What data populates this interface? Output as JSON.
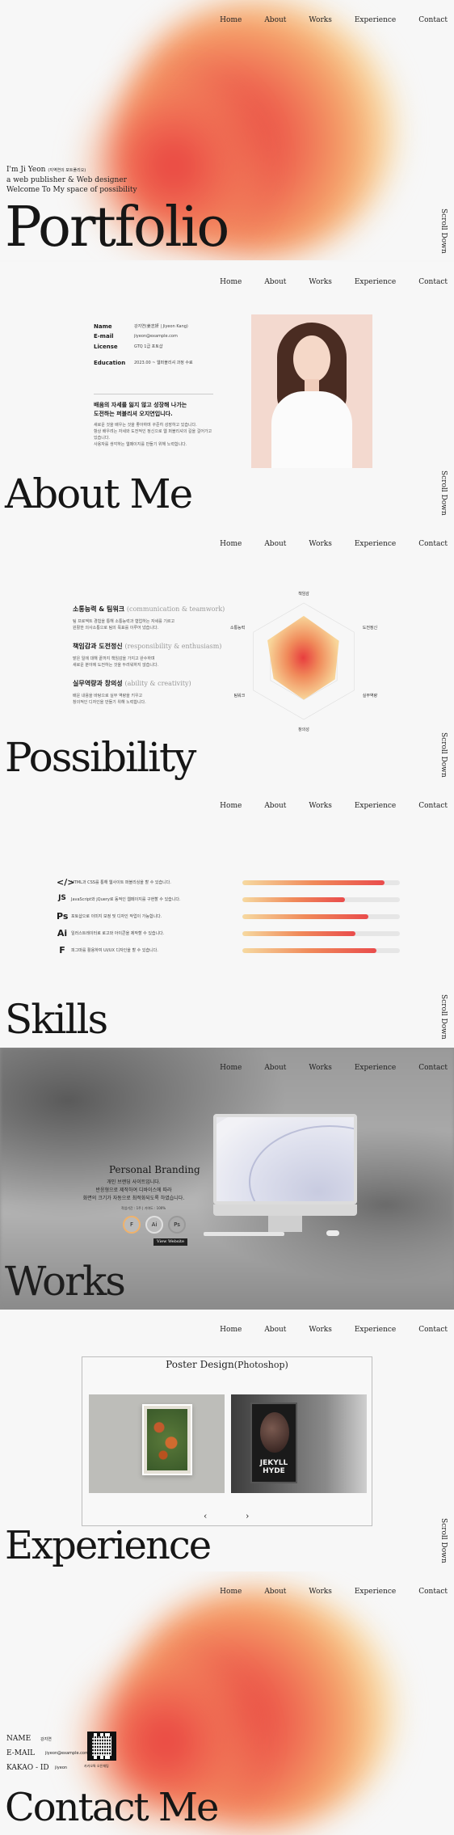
{
  "nav": [
    "Home",
    "About",
    "Works",
    "Experience",
    "Contact"
  ],
  "scroll_label": "Scroll Down",
  "hero": {
    "line1": "I'm Ji Yeon",
    "line1_small": "(지역연의 포트폴리오)",
    "line2": "a  web publisher & Web designer",
    "line3": "Welcome To My space of possibility",
    "title": "Portfolio"
  },
  "about": {
    "title": "About Me",
    "rows": [
      {
        "k": "Name",
        "v": "강지연(姜志妍 | Jiyeon Kang)"
      },
      {
        "k": "E-mail",
        "v": "jiyeon@example.com"
      },
      {
        "k": "License",
        "v": "GTQ 1급 포토샵"
      },
      {
        "k": "Education",
        "v": "2023.00 ~ 웹퍼블리셔 과정 수료"
      }
    ],
    "headline": "배움의 자세를 잃지 않고 성장해 나가는\n도전하는 퍼블리셔 오지연입니다.",
    "desc": "새로운 것을 배우는 것을 좋아하며 꾸준히 성장하고 있습니다.\n항상 배우려는 자세와 도전적인 정신으로 웹 퍼블리셔의 길을 걸어가고 있습니다.\n사용자를 생각하는 웹페이지를 만들기 위해 노력합니다."
  },
  "possibility": {
    "title": "Possibility",
    "items": [
      {
        "h": "소통능력 & 팀워크",
        "en": "(communication & teamwork)",
        "d": "팀 프로젝트 경험을 통해 소통능력과 협업하는 자세를 기르고\n원활한 의사소통으로 팀의 목표를 이루어 냈습니다."
      },
      {
        "h": "책임감과 도전정신",
        "en": "(responsibility & enthusiasm)",
        "d": "맡은 일에 대해 끝까지 책임감을 가지고 완수하며\n새로운 분야에 도전하는 것을 두려워하지 않습니다."
      },
      {
        "h": "실무역량과 창의성",
        "en": "(ability & creativity)",
        "d": "배운 내용을 바탕으로 실무 역량을 키우고\n창의적인 디자인을 만들기 위해 노력합니다."
      }
    ],
    "chart_labels": [
      "책임감",
      "도전정신",
      "실무역량",
      "창의성",
      "팀워크",
      "소통능력"
    ],
    "chart_values": [
      0.78,
      0.7,
      0.62,
      0.66,
      0.6,
      0.72
    ]
  },
  "skills": {
    "title": "Skills",
    "rows": [
      {
        "icon": "HTML",
        "text": "HTML과 CSS를 통해 웹사이트 퍼블리싱을 할 수 있습니다.",
        "level": 0.9
      },
      {
        "icon": "JS",
        "text": "JavaScript와 jQuery로 동적인 웹페이지를 구현할 수 있습니다.",
        "level": 0.65
      },
      {
        "icon": "Ps",
        "text": "포토샵으로 이미지 보정 및 디자인 작업이 가능합니다.",
        "level": 0.8
      },
      {
        "icon": "Ai",
        "text": "일러스트레이터로 로고와 아이콘을 제작할 수 있습니다.",
        "level": 0.72
      },
      {
        "icon": "F",
        "text": "피그마를 활용하여 UI/UX 디자인을 할 수 있습니다.",
        "level": 0.85
      }
    ]
  },
  "works": {
    "title": "Works",
    "project_title": "Personal Branding",
    "project_desc": "개인 브랜딩 사이트입니다.\n반응형으로 제작하여 디바이스에 따라\n화면의 크기가 자동으로 최적화되도록 하였습니다.",
    "period": "작업기간 : 1주 | 기여도 : 100%",
    "tools": [
      "F",
      "Ai",
      "Ps"
    ],
    "button": "View Website"
  },
  "experience": {
    "title": "Experience",
    "card_title": "Poster Design",
    "card_sub": "(Photoshop)",
    "poster_text": "JEKYLL HYDE",
    "prev": "‹",
    "next": "›"
  },
  "contact": {
    "title": "Contact Me",
    "rows": [
      {
        "k": "NAME",
        "v": "강지연"
      },
      {
        "k": "E-MAIL",
        "v": "jiyeon@example.com"
      },
      {
        "k": "KAKAO - ID",
        "v": "jiyeon"
      }
    ],
    "qr_caption": "카카오톡 오픈채팅"
  },
  "colors": {
    "accent": "#ec4a43",
    "orange": "#f5a36a",
    "yellow": "#f8d69a"
  }
}
